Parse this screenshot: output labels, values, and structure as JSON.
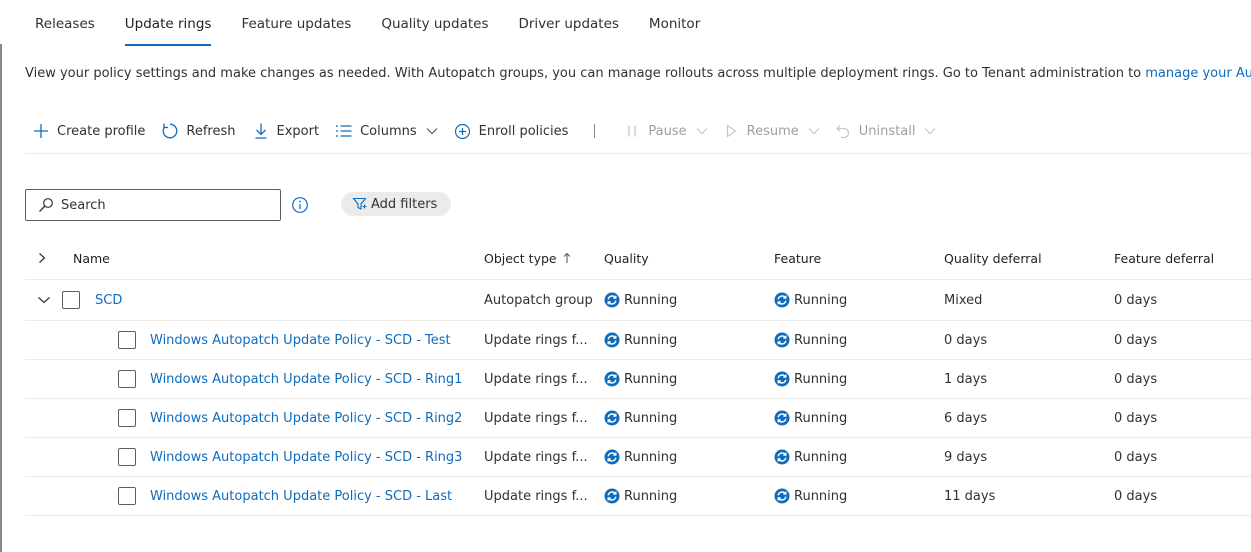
{
  "tabs": [
    {
      "label": "Releases",
      "active": false
    },
    {
      "label": "Update rings",
      "active": true
    },
    {
      "label": "Feature updates",
      "active": false
    },
    {
      "label": "Quality updates",
      "active": false
    },
    {
      "label": "Driver updates",
      "active": false
    },
    {
      "label": "Monitor",
      "active": false
    }
  ],
  "description": {
    "text": "View your policy settings and make changes as needed. With Autopatch groups, you can manage rollouts across multiple deployment rings. Go to Tenant administration to ",
    "link": "manage your Autopatch gr"
  },
  "toolbar": {
    "create_profile": "Create profile",
    "refresh": "Refresh",
    "export": "Export",
    "columns": "Columns",
    "enroll_policies": "Enroll policies",
    "pause": "Pause",
    "resume": "Resume",
    "uninstall": "Uninstall"
  },
  "search": {
    "placeholder": "Search"
  },
  "filters": {
    "add_filters": "Add filters"
  },
  "table": {
    "columns": {
      "name": "Name",
      "object_type": "Object type",
      "quality": "Quality",
      "feature": "Feature",
      "quality_deferral": "Quality deferral",
      "feature_deferral": "Feature deferral"
    },
    "group": {
      "name": "SCD",
      "object_type": "Autopatch group",
      "quality": "Running",
      "feature": "Running",
      "quality_deferral": "Mixed",
      "feature_deferral": "0 days"
    },
    "rows": [
      {
        "name": "Windows Autopatch Update Policy - SCD - Test",
        "object_type": "Update rings f...",
        "quality": "Running",
        "feature": "Running",
        "quality_deferral": "0 days",
        "feature_deferral": "0 days"
      },
      {
        "name": "Windows Autopatch Update Policy - SCD - Ring1",
        "object_type": "Update rings f...",
        "quality": "Running",
        "feature": "Running",
        "quality_deferral": "1 days",
        "feature_deferral": "0 days"
      },
      {
        "name": "Windows Autopatch Update Policy - SCD - Ring2",
        "object_type": "Update rings f...",
        "quality": "Running",
        "feature": "Running",
        "quality_deferral": "6 days",
        "feature_deferral": "0 days"
      },
      {
        "name": "Windows Autopatch Update Policy - SCD - Ring3",
        "object_type": "Update rings f...",
        "quality": "Running",
        "feature": "Running",
        "quality_deferral": "9 days",
        "feature_deferral": "0 days"
      },
      {
        "name": "Windows Autopatch Update Policy - SCD - Last",
        "object_type": "Update rings f...",
        "quality": "Running",
        "feature": "Running",
        "quality_deferral": "11 days",
        "feature_deferral": "0 days"
      }
    ]
  },
  "colors": {
    "accent": "#0f6cbd",
    "status_running": "#0f6cbd",
    "disabled_text": "#a19f9d"
  },
  "icons": {
    "create_profile": "plus-icon",
    "refresh": "refresh-icon",
    "export": "download-icon",
    "columns": "columns-icon",
    "enroll_policies": "add-circle-icon",
    "pause": "pause-icon",
    "resume": "play-icon",
    "uninstall": "undo-icon",
    "search": "search-icon",
    "info": "info-icon",
    "filter": "filter-icon",
    "status": "sync-running-icon"
  }
}
